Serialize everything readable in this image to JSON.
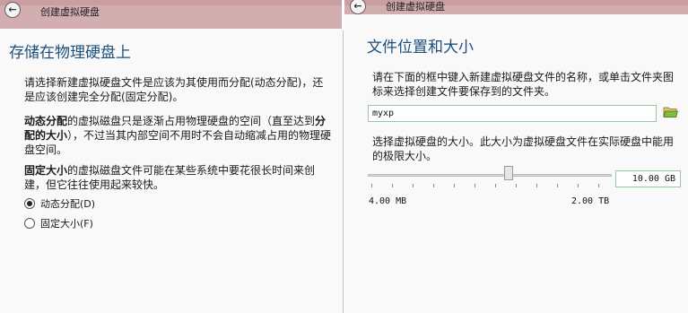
{
  "left": {
    "title": "创建虚拟硬盘",
    "back_glyph": "←",
    "heading": "存储在物理硬盘上",
    "para1": "请选择新建虚拟硬盘文件是应该为其使用而分配(动态分配)，还是应该创建完全分配(固定分配)。",
    "para2_bold1": "动态分配",
    "para2_text1": "的虚拟磁盘只是逐渐占用物理硬盘的空间（直至达到",
    "para2_bold2": "分配的大小",
    "para2_text2": "），不过当其内部空间不用时不会自动缩减占用的物理硬盘空间。",
    "para3_bold": "固定大小",
    "para3_text": "的虚拟磁盘文件可能在某些系统中要花很长时间来创建，但它往往使用起来较快。",
    "options": [
      {
        "label": "动态分配(D)",
        "checked": true
      },
      {
        "label": "固定大小(F)",
        "checked": false
      }
    ]
  },
  "right": {
    "title": "创建虚拟硬盘",
    "back_glyph": "←",
    "heading": "文件位置和大小",
    "instructions": "请在下面的框中键入新建虚拟硬盘文件的名称，或单击文件夹图标来选择创建文件要保存到的文件夹。",
    "filename_value": "myxp",
    "folder_icon": "folder-open-icon",
    "size_instructions": "选择虚拟硬盘的大小。此大小为虚拟硬盘文件在实际硬盘中能用的极限大小。",
    "size_value": "10.00 GB",
    "slider_min_label": "4.00 MB",
    "slider_max_label": "2.00 TB",
    "slider_position": 0.57
  },
  "colors": {
    "titlebar": "#d2aeb0",
    "heading": "#1d4f7c",
    "input_border": "#9ec69e",
    "folder_accent": "#7cbf3c"
  }
}
